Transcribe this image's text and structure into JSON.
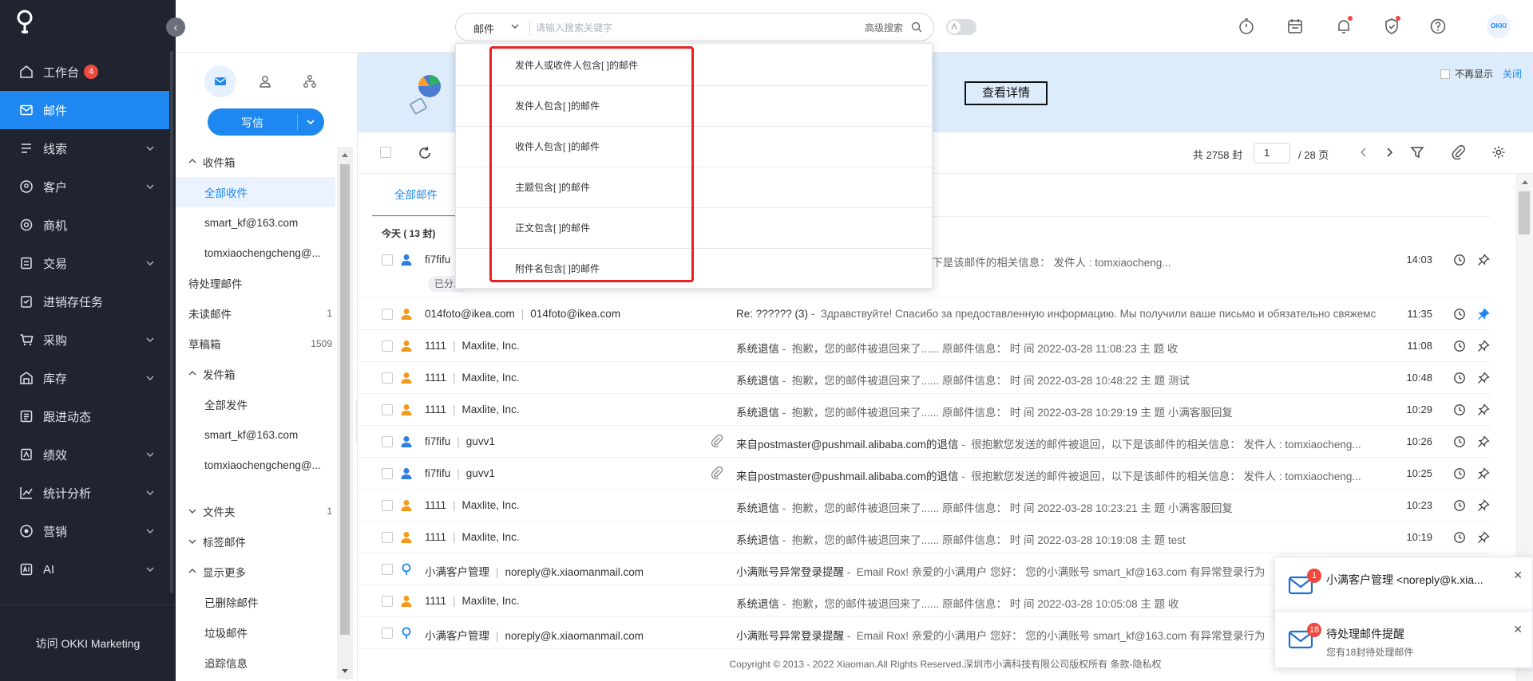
{
  "nav": {
    "items": [
      {
        "label": "工作台",
        "badge": "4",
        "icon": "home-icon"
      },
      {
        "label": "邮件",
        "icon": "mail-icon",
        "active": true
      },
      {
        "label": "线索",
        "icon": "clue-icon",
        "chevron": true
      },
      {
        "label": "客户",
        "icon": "customer-icon",
        "chevron": true
      },
      {
        "label": "商机",
        "icon": "opportunity-icon"
      },
      {
        "label": "交易",
        "icon": "deal-icon",
        "chevron": true
      },
      {
        "label": "进销存任务",
        "icon": "task-icon"
      },
      {
        "label": "采购",
        "icon": "cart-icon",
        "chevron": true
      },
      {
        "label": "库存",
        "icon": "warehouse-icon",
        "chevron": true
      },
      {
        "label": "跟进动态",
        "icon": "follow-icon"
      },
      {
        "label": "绩效",
        "icon": "performance-icon",
        "chevron": true
      },
      {
        "label": "统计分析",
        "icon": "chart-icon",
        "chevron": true
      },
      {
        "label": "营销",
        "icon": "marketing-icon",
        "chevron": true
      },
      {
        "label": "AI",
        "icon": "ai-icon",
        "chevron": true
      }
    ],
    "footer": "访问 OKKI Marketing"
  },
  "search": {
    "scope": "邮件",
    "placeholder": "请输入搜索关键字",
    "advanced": "高级搜索"
  },
  "dropdown": {
    "options": [
      "发件人或收件人包含[ ]的邮件",
      "发件人包含[ ]的邮件",
      "收件人包含[ ]的邮件",
      "主题包含[ ]的邮件",
      "正文包含[ ]的邮件",
      "附件名包含[ ]的邮件"
    ]
  },
  "user": {
    "avatar_text": "OKKI"
  },
  "compose": {
    "label": "写信"
  },
  "folders": [
    {
      "label": "收件箱",
      "type": "grp",
      "caret": "up"
    },
    {
      "label": "全部收件",
      "type": "l1",
      "selected": true
    },
    {
      "label": "smart_kf@163.com",
      "type": "l1"
    },
    {
      "label": "tomxiaochengcheng@...",
      "type": "l1"
    },
    {
      "label": "待处理邮件",
      "type": "l0"
    },
    {
      "label": "未读邮件",
      "type": "l0",
      "count": "1"
    },
    {
      "label": "草稿箱",
      "type": "l0",
      "count": "1509"
    },
    {
      "label": "发件箱",
      "type": "grp",
      "caret": "up"
    },
    {
      "label": "全部发件",
      "type": "l1"
    },
    {
      "label": "smart_kf@163.com",
      "type": "l1"
    },
    {
      "label": "tomxiaochengcheng@...",
      "type": "l1"
    },
    {
      "label": "",
      "type": "gap"
    },
    {
      "label": "文件夹",
      "type": "grp",
      "caret": "down",
      "count": "1"
    },
    {
      "label": "标签邮件",
      "type": "grp",
      "caret": "down"
    },
    {
      "label": "显示更多",
      "type": "grp",
      "caret": "up"
    },
    {
      "label": "已删除邮件",
      "type": "l1"
    },
    {
      "label": "垃圾邮件",
      "type": "l1"
    },
    {
      "label": "追踪信息",
      "type": "l1"
    }
  ],
  "banner": {
    "detail_button": "查看详情",
    "no_more": "不再显示",
    "close": "关闭"
  },
  "toolbar": {
    "total": "共 2758 封",
    "page": "1",
    "page_of": "/  28  页"
  },
  "tabs": {
    "active": "全部邮件"
  },
  "group_header": "今天 ( 13 封)",
  "emails": [
    {
      "sender": "fi7fifu",
      "to": "",
      "subject": "的退信",
      "preview": "很抱歉您发送的邮件被退回，以下是该邮件的相关信息：  发件人 : tomxiaocheng...",
      "time": "14:03",
      "icon": "person-blue",
      "attach": false,
      "pinned": false,
      "tag": "已分..."
    },
    {
      "sender": "014foto@ikea.com",
      "to": "014foto@ikea.com",
      "subject": "Re: ?????? (3)",
      "preview": "Здравствуйте! Спасибо за предоставленную информацию. Мы получили ваше письмо и обязательно свяжемс",
      "time": "11:35",
      "icon": "person-orange",
      "attach": false,
      "pinned": true
    },
    {
      "sender": "1111",
      "to": "Maxlite, Inc.",
      "subject": "系统退信",
      "preview": "抱歉，您的邮件被退回来了...... 原邮件信息：  时 间 2022-03-28 11:08:23 主 题 收",
      "time": "11:08",
      "icon": "person-orange",
      "attach": false,
      "pinned": false
    },
    {
      "sender": "1111",
      "to": "Maxlite, Inc.",
      "subject": "系统退信",
      "preview": "抱歉，您的邮件被退回来了...... 原邮件信息：  时 间 2022-03-28 10:48:22 主 题 测试",
      "time": "10:48",
      "icon": "person-orange",
      "attach": false,
      "pinned": false
    },
    {
      "sender": "1111",
      "to": "Maxlite, Inc.",
      "subject": "系统退信",
      "preview": "抱歉，您的邮件被退回来了...... 原邮件信息：  时 间 2022-03-28 10:29:19 主 题 小满客服回复",
      "time": "10:29",
      "icon": "person-orange",
      "attach": false,
      "pinned": false
    },
    {
      "sender": "fi7fifu",
      "to": "guvv1",
      "subject": "来自postmaster@pushmail.alibaba.com的退信",
      "preview": "很抱歉您发送的邮件被退回，以下是该邮件的相关信息：  发件人 : tomxiaocheng...",
      "time": "10:26",
      "icon": "person-blue",
      "attach": true,
      "pinned": false
    },
    {
      "sender": "fi7fifu",
      "to": "guvv1",
      "subject": "来自postmaster@pushmail.alibaba.com的退信",
      "preview": "很抱歉您发送的邮件被退回，以下是该邮件的相关信息：  发件人 : tomxiaocheng...",
      "time": "10:25",
      "icon": "person-blue",
      "attach": true,
      "pinned": false
    },
    {
      "sender": "1111",
      "to": "Maxlite, Inc.",
      "subject": "系统退信",
      "preview": "抱歉，您的邮件被退回来了...... 原邮件信息：  时 间 2022-03-28 10:23:21 主 题 小满客服回复",
      "time": "10:23",
      "icon": "person-orange",
      "attach": false,
      "pinned": false
    },
    {
      "sender": "1111",
      "to": "Maxlite, Inc.",
      "subject": "系统退信",
      "preview": "抱歉，您的邮件被退回来了...... 原邮件信息：  时 间 2022-03-28 10:19:08 主 题 test",
      "time": "10:19",
      "icon": "person-orange",
      "attach": false,
      "pinned": false
    },
    {
      "sender": "小满客户管理",
      "to": "noreply@k.xiaomanmail.com",
      "subject": "小满账号异常登录提醒",
      "preview": "Email Rox! 亲爱的小满用户 您好：  您的小满账号 smart_kf@163.com 有异常登录行为",
      "time": "",
      "icon": "location-blue",
      "attach": false,
      "pinned": false
    },
    {
      "sender": "1111",
      "to": "Maxlite, Inc.",
      "subject": "系统退信",
      "preview": "抱歉，您的邮件被退回来了...... 原邮件信息：  时 间 2022-03-28 10:05:08 主 题 收",
      "time": "",
      "icon": "person-orange",
      "attach": false,
      "pinned": false
    },
    {
      "sender": "小满客户管理",
      "to": "noreply@k.xiaomanmail.com",
      "subject": "小满账号异常登录提醒",
      "preview": "Email Rox! 亲爱的小满用户 您好：  您的小满账号 smart_kf@163.com 有异常登录行为",
      "time": "",
      "icon": "location-blue",
      "attach": false,
      "pinned": false
    }
  ],
  "copyright": "Copyright © 2013 - 2022 Xiaoman.All Rights Reserved.深圳市小满科技有限公司版权所有 条款-隐私权",
  "notifications": [
    {
      "badge": "1",
      "title": "小满客户管理 <noreply@k.xia...",
      "sub": ""
    },
    {
      "badge": "18",
      "title": "待处理邮件提醒",
      "sub": "您有18封待处理邮件"
    }
  ],
  "colors": {
    "accent": "#1e88f0",
    "nav_bg": "#1f2430",
    "highlight_red": "#ec1f1f"
  }
}
